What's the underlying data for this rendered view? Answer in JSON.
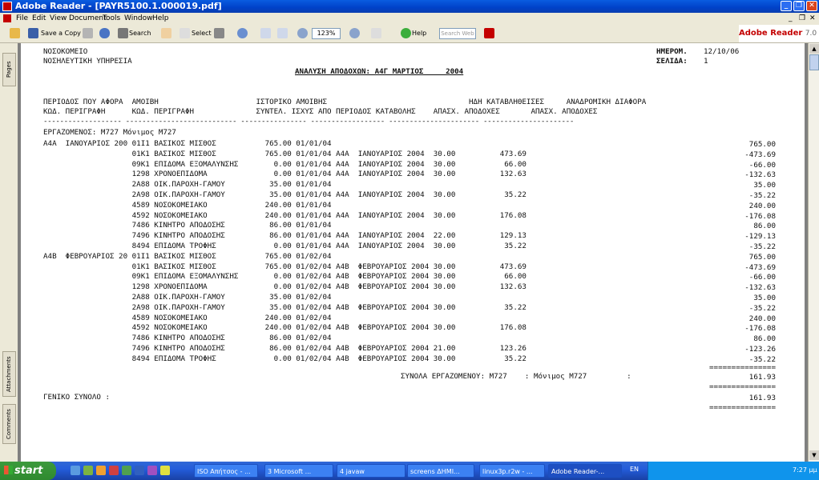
{
  "window": {
    "title": "Adobe Reader - [PAYR5100.1.000019.pdf]"
  },
  "menu": [
    "File",
    "Edit",
    "View",
    "Document",
    "Tools",
    "Window",
    "Help"
  ],
  "toolbar": {
    "save_copy": "Save a Copy",
    "search": "Search",
    "select": "Select",
    "zoom": "123%",
    "help": "Help",
    "search_web_placeholder": "Search Web",
    "brand": "Adobe Reader",
    "version": "7.0"
  },
  "nav_tabs": [
    "Pages",
    "Attachments",
    "Comments"
  ],
  "report": {
    "org1": "ΝΟΣΟΚΟΜΕΙΟ",
    "org2": "ΝΟΣΗΛΕΥΤΙΚΗ ΥΠΗΡΕΣΙΑ",
    "date_label": "ΗΜΕΡΟΜ.",
    "date_value": "12/10/06",
    "page_label": "ΣΕΛΙΔΑ:",
    "page_value": "1",
    "title": "ΑΝΑΛΥΣΗ ΑΠΟΔΟΧΩΝ: Α4Γ ΜΑΡΤΙΟΣ     2004",
    "header1": "ΠΕΡΙΟΔΟΣ ΠΟΥ ΑΦΟΡΑ  ΑΜΟΙΒΗ                      ΙΣΤΟΡΙΚΟ ΑΜΟΙΒΗΣ                                ΗΔΗ ΚΑΤΑΒΛΗΘΕΙΣΕΣ     ΑΝΑΔΡΟΜΙΚΗ ΔΙΑΦΟΡΑ",
    "header2": "ΚΩΔ. ΠΕΡΙΓΡΑΦΗ      ΚΩΔ. ΠΕΡΙΓΡΑΦΗ              ΣΥΝΤΕΛ. ΙΣΧΥΣ ΑΠΟ ΠΕΡΙΟΔΟΣ ΚΑΤΑΒΟΛΗΣ    ΑΠΑΣΧ. ΑΠΟΔΟΧΕΣ       ΑΠΑΣΧ. ΑΠΟΔΟΧΕΣ",
    "dashes": "------------------- --------------------------- ---------------- ------------------ ---------------------- ----------------------",
    "employee": "ΕΡΓΑΖΟΜΕΝΟΣ: Μ727 Μόνιμος Μ727",
    "rows": [
      {
        "l": "Α4Α  ΙΑΝΟΥΑΡΙΟΣ 200 01Ι1 ΒΑΣΙΚΟΣ ΜΙΣΘΟΣ           765.00 01/01/04",
        "r": "765.00"
      },
      {
        "l": "                    01Κ1 ΒΑΣΙΚΟΣ ΜΙΣΘΟΣ           765.00 01/01/04 Α4Α  ΙΑΝΟΥΑΡΙΟΣ 2004  30.00          473.69",
        "r": "-473.69"
      },
      {
        "l": "                    09Κ1 ΕΠΙΔΟΜΑ ΕΞΟΜΑΛΥΝΣΗΣ        0.00 01/01/04 Α4Α  ΙΑΝΟΥΑΡΙΟΣ 2004  30.00           66.00",
        "r": "-66.00"
      },
      {
        "l": "                    1298 ΧΡΟΝΟΕΠΙΔΟΜΑ               0.00 01/01/04 Α4Α  ΙΑΝΟΥΑΡΙΟΣ 2004  30.00          132.63",
        "r": "-132.63"
      },
      {
        "l": "                    2Α88 ΟΙΚ.ΠΑΡΟΧΗ-ΓΑΜΟΥ          35.00 01/01/04",
        "r": "35.00"
      },
      {
        "l": "                    2Α98 ΟΙΚ.ΠΑΡΟΧΗ-ΓΑΜΟΥ          35.00 01/01/04 Α4Α  ΙΑΝΟΥΑΡΙΟΣ 2004  30.00           35.22",
        "r": "-35.22"
      },
      {
        "l": "                    4589 ΝΟΣΟΚΟΜΕΙΑΚΟ             240.00 01/01/04",
        "r": "240.00"
      },
      {
        "l": "                    4592 ΝΟΣΟΚΟΜΕΙΑΚΟ             240.00 01/01/04 Α4Α  ΙΑΝΟΥΑΡΙΟΣ 2004  30.00          176.08",
        "r": "-176.08"
      },
      {
        "l": "                    7486 ΚΙΝΗΤΡΟ ΑΠΟΔΟΣΗΣ          86.00 01/01/04",
        "r": "86.00"
      },
      {
        "l": "                    7496 ΚΙΝΗΤΡΟ ΑΠΟΔΟΣΗΣ          86.00 01/01/04 Α4Α  ΙΑΝΟΥΑΡΙΟΣ 2004  22.00          129.13",
        "r": "-129.13"
      },
      {
        "l": "                    8494 ΕΠΙΔΟΜΑ ΤΡΟΦΗΣ             0.00 01/01/04 Α4Α  ΙΑΝΟΥΑΡΙΟΣ 2004  30.00           35.22",
        "r": "-35.22"
      },
      {
        "l": "Α4Β  ΦΕΒΡΟΥΑΡΙΟΣ 20 01Ι1 ΒΑΣΙΚΟΣ ΜΙΣΘΟΣ           765.00 01/02/04",
        "r": "765.00"
      },
      {
        "l": "                    01Κ1 ΒΑΣΙΚΟΣ ΜΙΣΘΟΣ           765.00 01/02/04 Α4Β  ΦΕΒΡΟΥΑΡΙΟΣ 2004 30.00          473.69",
        "r": "-473.69"
      },
      {
        "l": "                    09Κ1 ΕΠΙΔΟΜΑ ΕΞΟΜΑΛΥΝΣΗΣ        0.00 01/02/04 Α4Β  ΦΕΒΡΟΥΑΡΙΟΣ 2004 30.00           66.00",
        "r": "-66.00"
      },
      {
        "l": "                    1298 ΧΡΟΝΟΕΠΙΔΟΜΑ               0.00 01/02/04 Α4Β  ΦΕΒΡΟΥΑΡΙΟΣ 2004 30.00          132.63",
        "r": "-132.63"
      },
      {
        "l": "                    2Α88 ΟΙΚ.ΠΑΡΟΧΗ-ΓΑΜΟΥ          35.00 01/02/04",
        "r": "35.00"
      },
      {
        "l": "                    2Α98 ΟΙΚ.ΠΑΡΟΧΗ-ΓΑΜΟΥ          35.00 01/02/04 Α4Β  ΦΕΒΡΟΥΑΡΙΟΣ 2004 30.00           35.22",
        "r": "-35.22"
      },
      {
        "l": "                    4589 ΝΟΣΟΚΟΜΕΙΑΚΟ             240.00 01/02/04",
        "r": "240.00"
      },
      {
        "l": "                    4592 ΝΟΣΟΚΟΜΕΙΑΚΟ             240.00 01/02/04 Α4Β  ΦΕΒΡΟΥΑΡΙΟΣ 2004 30.00          176.08",
        "r": "-176.08"
      },
      {
        "l": "                    7486 ΚΙΝΗΤΡΟ ΑΠΟΔΟΣΗΣ          86.00 01/02/04",
        "r": "86.00"
      },
      {
        "l": "                    7496 ΚΙΝΗΤΡΟ ΑΠΟΔΟΣΗΣ          86.00 01/02/04 Α4Β  ΦΕΒΡΟΥΑΡΙΟΣ 2004 21.00          123.26",
        "r": "-123.26"
      },
      {
        "l": "                    8494 ΕΠΙΔΟΜΑ ΤΡΟΦΗΣ             0.00 01/02/04 Α4Β  ΦΕΒΡΟΥΑΡΙΟΣ 2004 30.00           35.22",
        "r": "-35.22"
      }
    ],
    "eq_line": "===============",
    "subtotal_label": "ΣΥΝΟΛΑ ΕΡΓΑΖΟΜΕΝΟΥ: Μ727    : Μόνιμος Μ727         :",
    "subtotal_value": "161.93",
    "grand_label": "ΓΕΝΙΚΟ ΣΥΝΟΛΟ :",
    "grand_value": "161.93"
  },
  "taskbar": {
    "start": "start",
    "tasks": [
      "ISO Απήτσος - ...",
      "3 Microsoft ...",
      "4 javaw",
      "screens ΔΗΜΙ...",
      "linux3p.r2w - ...",
      "Adobe Reader-..."
    ],
    "lang": "EN",
    "clock": "7:27 μμ"
  }
}
